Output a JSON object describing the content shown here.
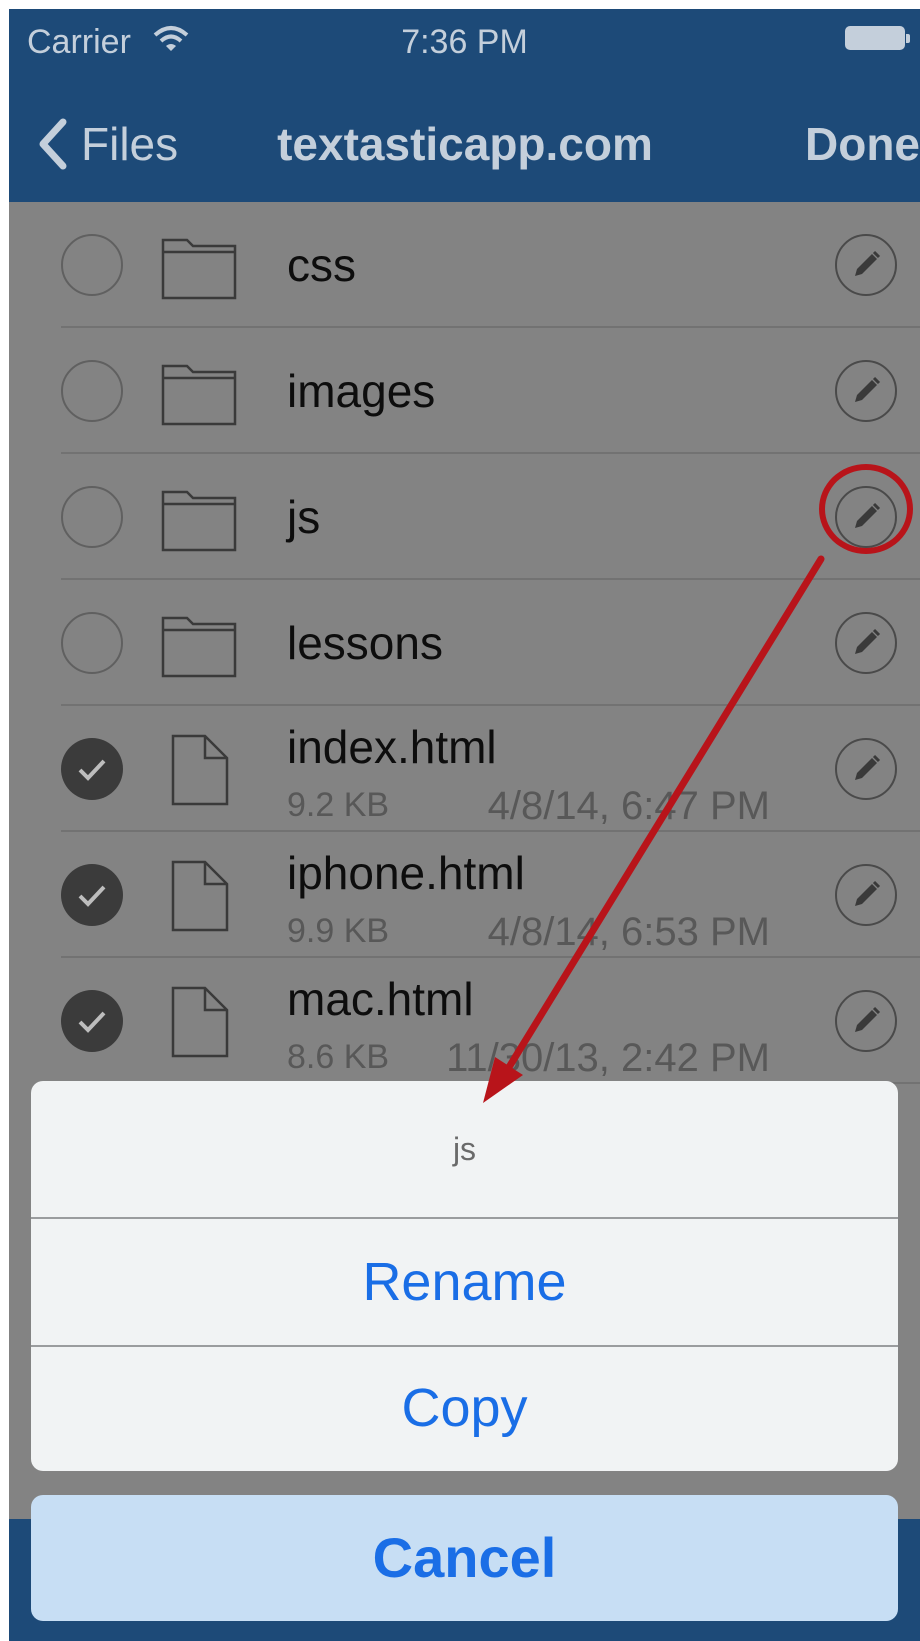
{
  "status_bar": {
    "carrier": "Carrier",
    "time": "7:36 PM"
  },
  "nav": {
    "back_label": "Files",
    "title": "textasticapp.com",
    "done_label": "Done"
  },
  "items": [
    {
      "name": "css",
      "type": "folder",
      "selected": false
    },
    {
      "name": "images",
      "type": "folder",
      "selected": false
    },
    {
      "name": "js",
      "type": "folder",
      "selected": false
    },
    {
      "name": "lessons",
      "type": "folder",
      "selected": false
    },
    {
      "name": "index.html",
      "type": "file",
      "selected": true,
      "size": "9.2 KB",
      "date": "4/8/14, 6:47 PM"
    },
    {
      "name": "iphone.html",
      "type": "file",
      "selected": true,
      "size": "9.9 KB",
      "date": "4/8/14, 6:53 PM"
    },
    {
      "name": "mac.html",
      "type": "file",
      "selected": true,
      "size": "8.6 KB",
      "date": "11/30/13, 2:42 PM"
    }
  ],
  "action_sheet": {
    "title": "js",
    "rename_label": "Rename",
    "copy_label": "Copy",
    "cancel_label": "Cancel"
  },
  "colors": {
    "bar": "#1d4a78",
    "accent": "#1a6ee6",
    "annotation": "#b8141a"
  }
}
